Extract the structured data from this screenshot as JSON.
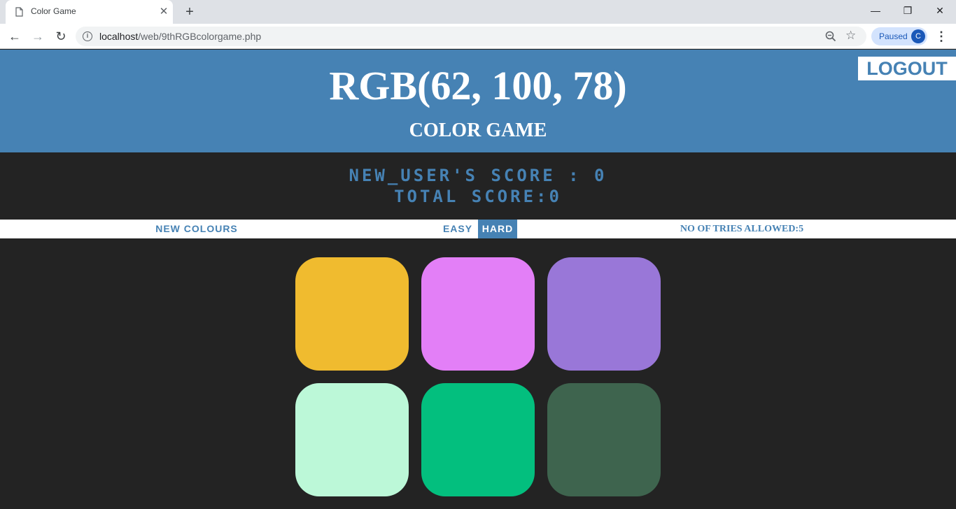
{
  "browser": {
    "tab_title": "Color Game",
    "url_host": "localhost",
    "url_path": "/web/9thRGBcolorgame.php",
    "profile_status": "Paused",
    "profile_initial": "C"
  },
  "header": {
    "rgb_display": "RGB(62, 100, 78)",
    "game_title": "COLOR GAME",
    "logout_label": "LOGOUT"
  },
  "score": {
    "user_score": "NEW_USER'S SCORE : 0",
    "total_score": "TOTAL SCORE:0"
  },
  "controls": {
    "new_colours_label": "NEW COLOURS",
    "easy_label": "EASY",
    "hard_label": "HARD",
    "selected_mode": "HARD",
    "tries_label": "NO OF TRIES ALLOWED:5"
  },
  "colors": {
    "accent": "#4682b4",
    "background": "#232323"
  },
  "squares": [
    {
      "name": "square-1",
      "color": "#f0bb2f"
    },
    {
      "name": "square-2",
      "color": "#e37ff7"
    },
    {
      "name": "square-3",
      "color": "#9977d8"
    },
    {
      "name": "square-4",
      "color": "#bcf8d8"
    },
    {
      "name": "square-5",
      "color": "#03bf7e"
    },
    {
      "name": "square-6",
      "color": "#3e644e"
    }
  ]
}
